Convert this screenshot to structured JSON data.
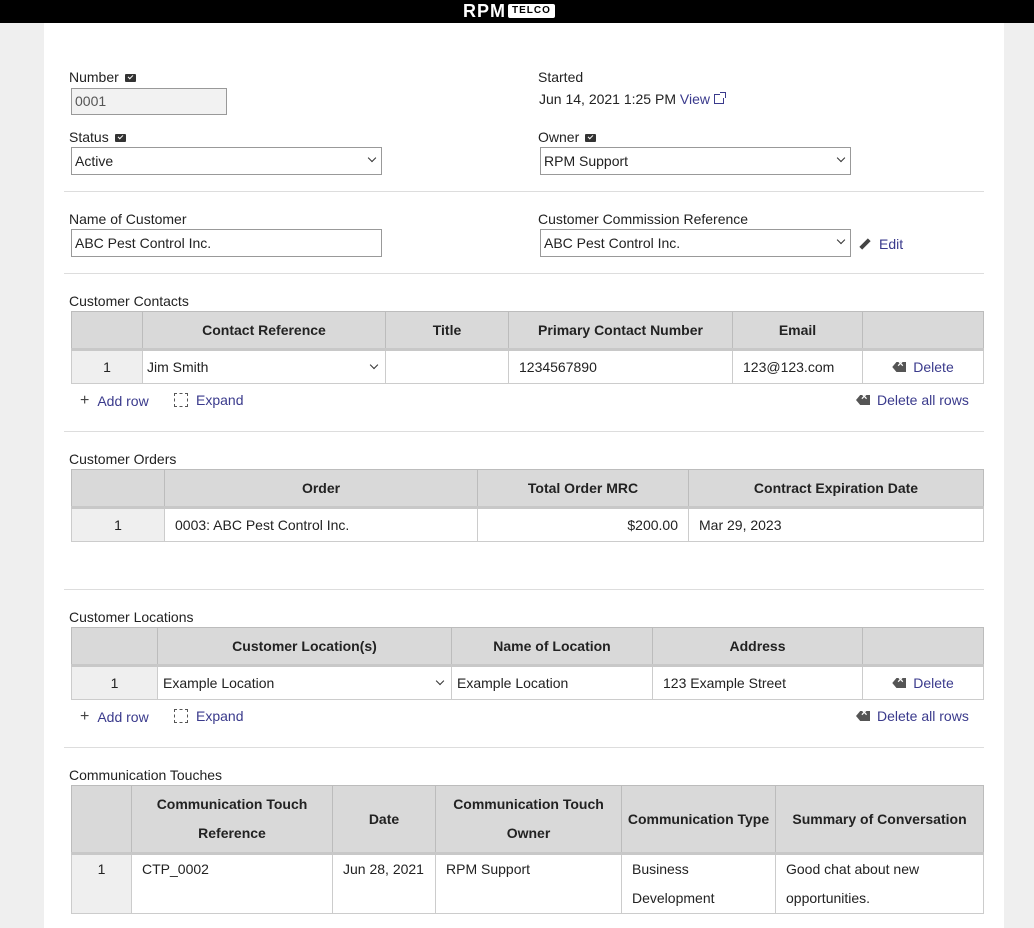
{
  "brand": {
    "logo_main": "RPM",
    "logo_badge": "TELCO"
  },
  "fields": {
    "number": {
      "label": "Number",
      "value": "0001"
    },
    "started": {
      "label": "Started",
      "value": "Jun 14, 2021 1:25 PM",
      "link": "View"
    },
    "status": {
      "label": "Status",
      "value": "Active"
    },
    "owner": {
      "label": "Owner",
      "value": "RPM Support"
    },
    "customer_name": {
      "label": "Name of Customer",
      "value": "ABC Pest Control Inc."
    },
    "commission_ref": {
      "label": "Customer Commission Reference",
      "value": "ABC Pest Control Inc.",
      "edit": "Edit"
    }
  },
  "contacts": {
    "title": "Customer Contacts",
    "headers": [
      "Contact Reference",
      "Title",
      "Primary Contact Number",
      "Email"
    ],
    "rows": [
      {
        "num": "1",
        "contact": "Jim Smith",
        "title": "",
        "phone": "1234567890",
        "email": "123@123.com",
        "delete": "Delete"
      }
    ],
    "add_row": "Add row",
    "expand": "Expand",
    "delete_all": "Delete all rows"
  },
  "orders": {
    "title": "Customer Orders",
    "headers": [
      "Order",
      "Total Order MRC",
      "Contract Expiration Date"
    ],
    "rows": [
      {
        "num": "1",
        "order": "0003: ABC Pest Control Inc.",
        "mrc": "$200.00",
        "expiration": "Mar 29, 2023"
      }
    ]
  },
  "locations": {
    "title": "Customer Locations",
    "headers": [
      "Customer Location(s)",
      "Name of Location",
      "Address"
    ],
    "rows": [
      {
        "num": "1",
        "location": "Example Location",
        "name": "Example Location",
        "address": "123 Example Street",
        "delete": "Delete"
      }
    ],
    "add_row": "Add row",
    "expand": "Expand",
    "delete_all": "Delete all rows"
  },
  "touches": {
    "title": "Communication Touches",
    "headers": [
      "Communication Touch Reference",
      "Date",
      "Communication Touch Owner",
      "Communication Type",
      "Summary of Conversation"
    ],
    "rows": [
      {
        "num": "1",
        "reference": "CTP_0002",
        "date": "Jun 28, 2021",
        "owner": "RPM Support",
        "type": "Business Development",
        "summary": "Good chat about new opportunities."
      }
    ]
  }
}
